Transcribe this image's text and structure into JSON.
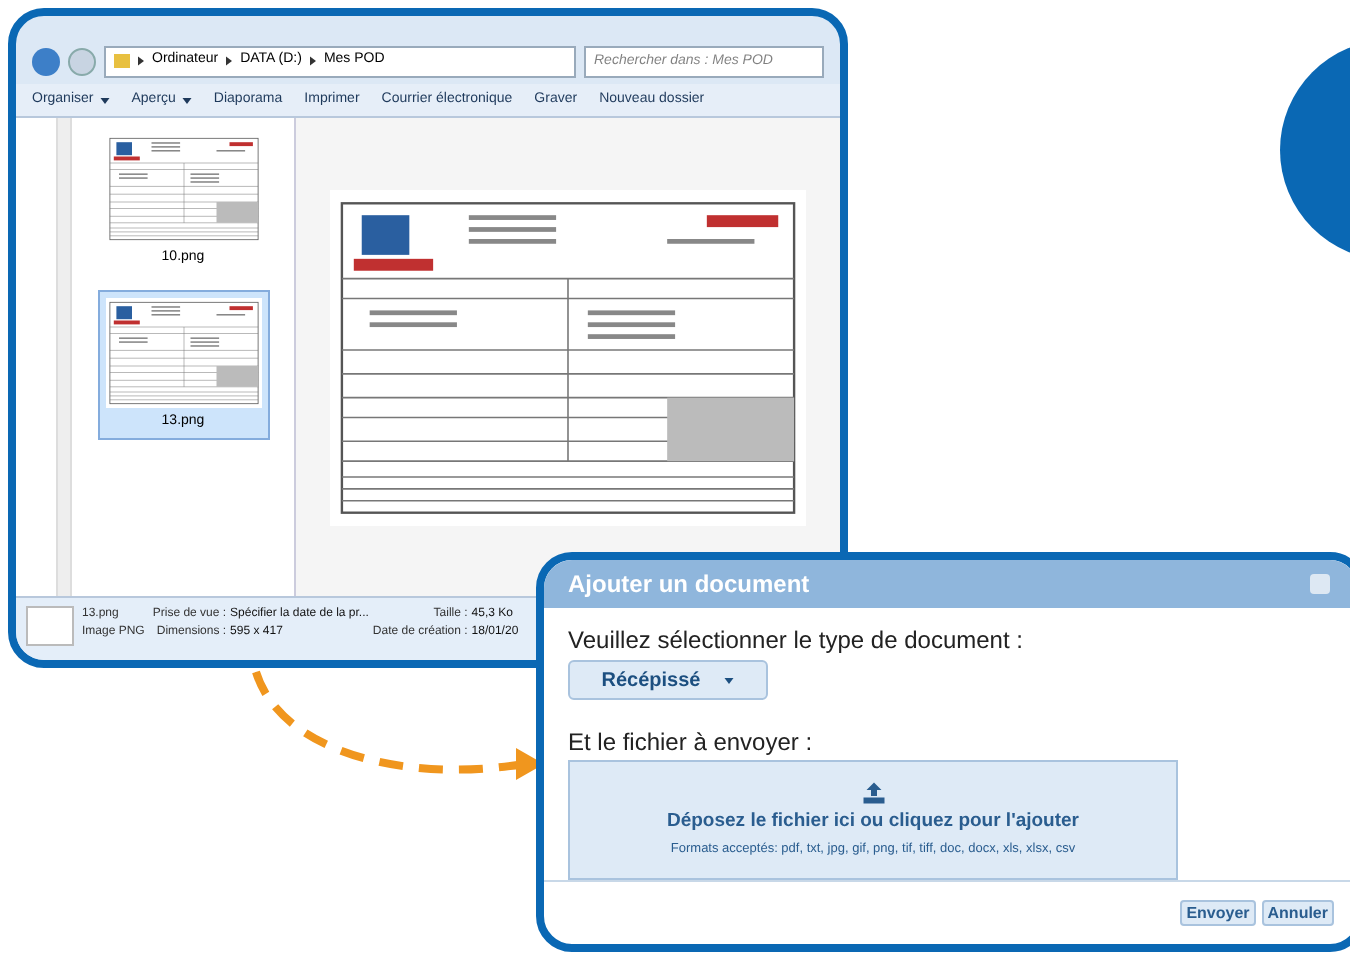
{
  "explorer": {
    "breadcrumb": [
      "Ordinateur",
      "DATA (D:)",
      "Mes POD"
    ],
    "search": {
      "placeholder": "Rechercher dans : Mes POD"
    },
    "toolbar": [
      {
        "label": "Organiser",
        "dropdown": true
      },
      {
        "label": "Aperçu",
        "dropdown": true
      },
      {
        "label": "Diaporama",
        "dropdown": false
      },
      {
        "label": "Imprimer",
        "dropdown": false
      },
      {
        "label": "Courrier électronique",
        "dropdown": false
      },
      {
        "label": "Graver",
        "dropdown": false
      },
      {
        "label": "Nouveau dossier",
        "dropdown": false
      }
    ],
    "thumbnails": [
      {
        "name": "10.png",
        "selected": false
      },
      {
        "name": "13.png",
        "selected": true
      }
    ],
    "details": {
      "name": "13.png",
      "type": "Image PNG",
      "fields": [
        {
          "label": "Prise de vue :",
          "value": "Spécifier la date de la pr..."
        },
        {
          "label": "Taille :",
          "value": "45,3 Ko"
        },
        {
          "label": "Dimensions :",
          "value": "595 x 417"
        },
        {
          "label": "Date de création :",
          "value": "18/01/20"
        }
      ]
    }
  },
  "dialog": {
    "title": "Ajouter un document",
    "type_label": "Veuillez sélectionner le type de document :",
    "type_value": "Récépissé",
    "file_label": "Et le fichier à envoyer :",
    "dropzone": {
      "title": "Déposez le fichier ici ou cliquez pour l'ajouter",
      "formats": "Formats acceptés: pdf, txt, jpg, gif, png, tif, tiff, doc, docx, xls, xlsx, csv"
    },
    "buttons": [
      "Envoyer",
      "Annuler"
    ]
  }
}
